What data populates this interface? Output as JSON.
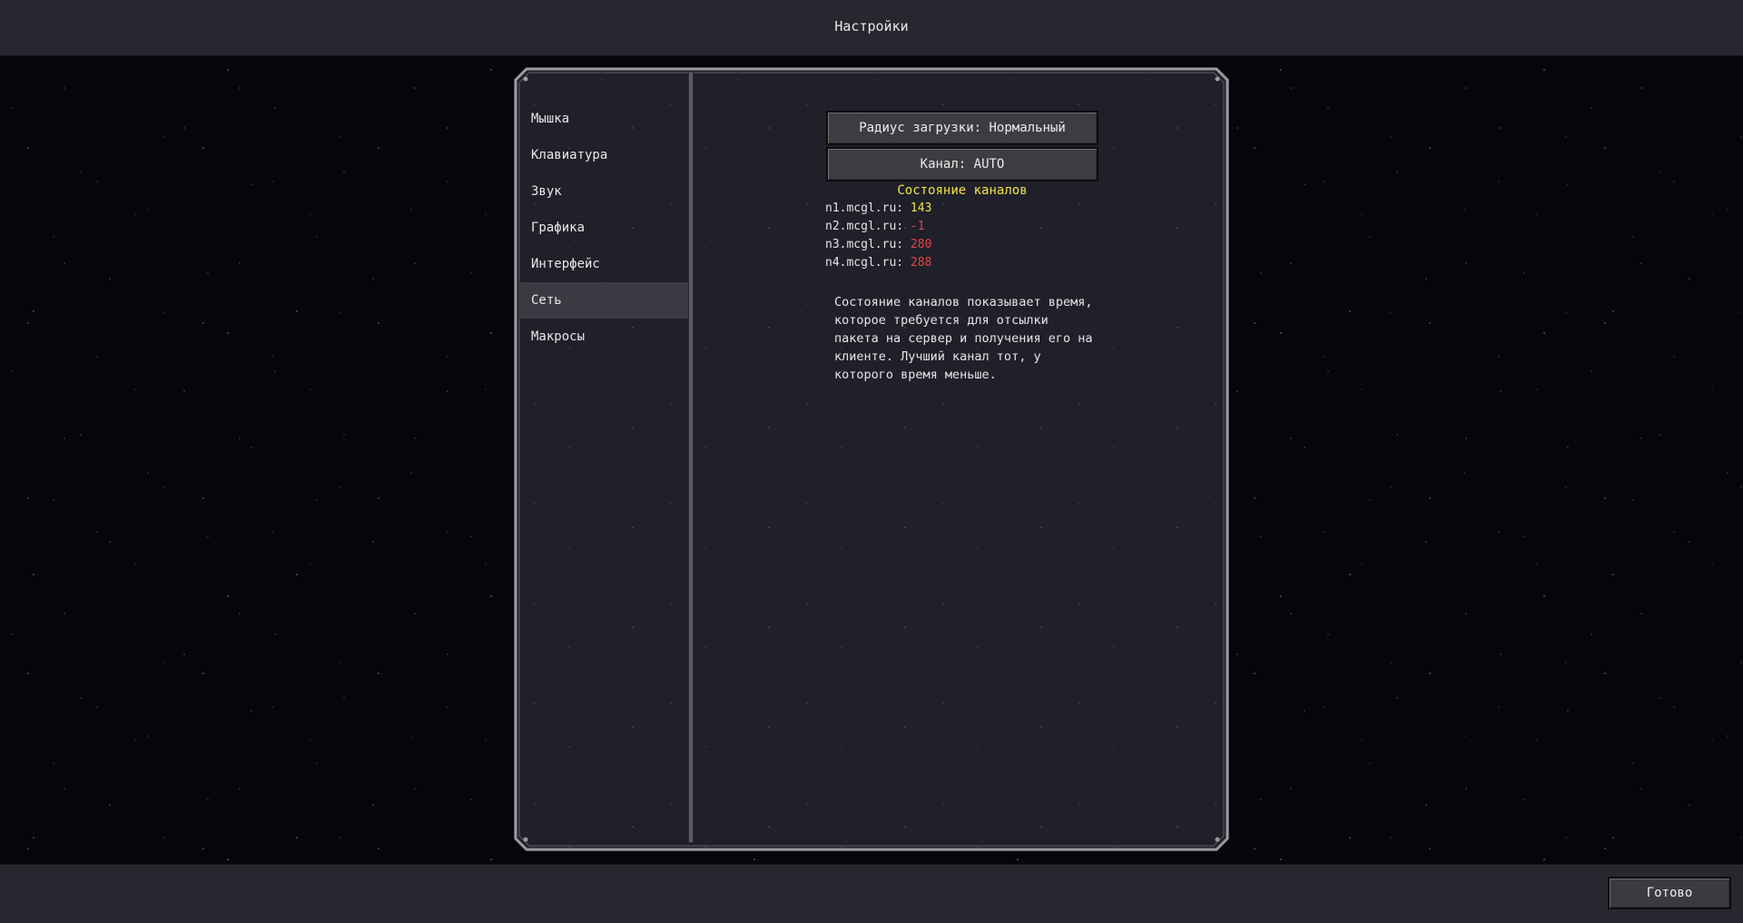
{
  "header": {
    "title": "Настройки"
  },
  "sidebar": {
    "items": [
      {
        "label": "Мышка"
      },
      {
        "label": "Клавиатура"
      },
      {
        "label": "Звук"
      },
      {
        "label": "Графика"
      },
      {
        "label": "Интерфейс"
      },
      {
        "label": "Сеть"
      },
      {
        "label": "Макросы"
      }
    ],
    "active": "Сеть"
  },
  "network": {
    "render_distance_button": "Радиус загрузки: Нормальный",
    "channel_button": "Канал: AUTO",
    "channels_status_title": "Состояние каналов",
    "channels": [
      {
        "host": "n1.mcgl.ru:",
        "ping": "143",
        "status": "ok"
      },
      {
        "host": "n2.mcgl.ru:",
        "ping": "-1",
        "status": "bad"
      },
      {
        "host": "n3.mcgl.ru:",
        "ping": "280",
        "status": "bad"
      },
      {
        "host": "n4.mcgl.ru:",
        "ping": "288",
        "status": "bad"
      }
    ],
    "description_lines": [
      "Состояние каналов показывает время,",
      "которое требуется для отсылки",
      "пакета на сервер и получения его на",
      "клиенте. Лучший канал тот, у",
      "которого время меньше."
    ]
  },
  "footer": {
    "done_label": "Готово"
  },
  "colors": {
    "ping_ok": "#f2e24a",
    "ping_bad": "#e14848",
    "status_title": "#f2e24a",
    "bar_bg": "#26272f",
    "panel_bg": "#1f2029"
  }
}
